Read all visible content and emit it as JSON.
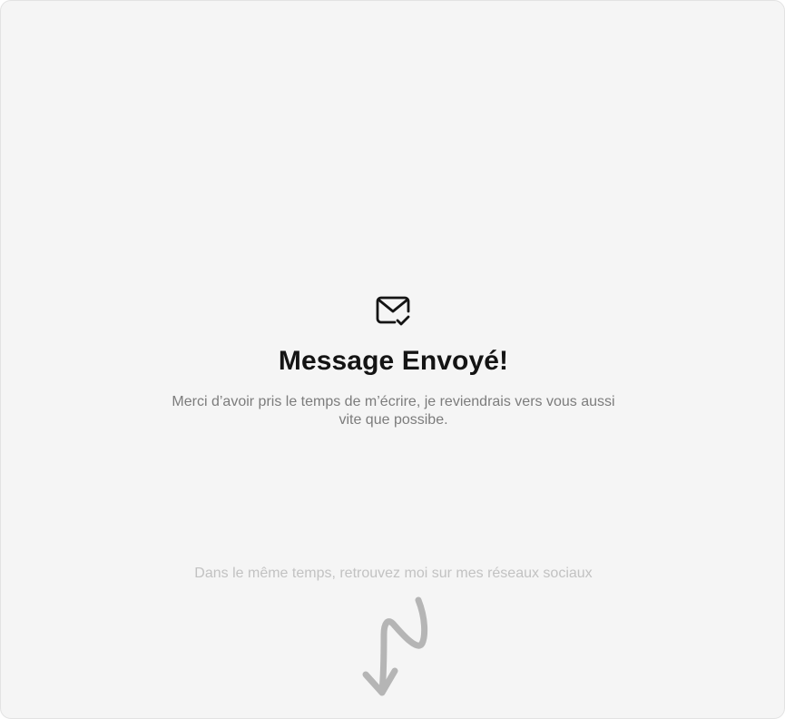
{
  "confirmation": {
    "icon": "mail-check-icon",
    "title": "Message Envoyé!",
    "message": "Merci d’avoir pris le temps de m’écrire, je reviendrais vers vous aussi vite que possibe.",
    "social_note": "Dans le même temps, retrouvez moi sur mes réseaux sociaux",
    "pointer_icon": "squiggle-arrow-down-icon"
  },
  "colors": {
    "background": "#f5f5f5",
    "title": "#141414",
    "message": "#7c7c7c",
    "social_note": "#c2c2c2",
    "arrow": "#b5b5b5"
  }
}
